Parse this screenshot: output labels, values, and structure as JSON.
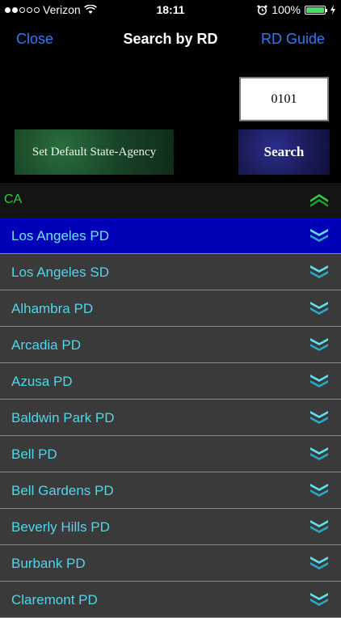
{
  "status_bar": {
    "carrier": "Verizon",
    "time": "18:11",
    "battery": "100%",
    "signal_bars": 2
  },
  "nav": {
    "close_label": "Close",
    "title": "Search by RD",
    "guide_label": "RD Guide"
  },
  "controls": {
    "rd_value": "0101",
    "default_state_label": "Set Default State-Agency",
    "search_label": "Search"
  },
  "state_header": {
    "state": "CA"
  },
  "agencies": [
    {
      "name": "Los Angeles PD",
      "selected": true
    },
    {
      "name": "Los Angeles SD",
      "selected": false
    },
    {
      "name": "Alhambra PD",
      "selected": false
    },
    {
      "name": "Arcadia PD",
      "selected": false
    },
    {
      "name": "Azusa PD",
      "selected": false
    },
    {
      "name": "Baldwin Park PD",
      "selected": false
    },
    {
      "name": "Bell PD",
      "selected": false
    },
    {
      "name": "Bell Gardens PD",
      "selected": false
    },
    {
      "name": "Beverly Hills PD",
      "selected": false
    },
    {
      "name": "Burbank PD",
      "selected": false
    },
    {
      "name": "Claremont PD",
      "selected": false
    }
  ],
  "colors": {
    "accent_blue": "#2f7bf6",
    "state_green": "#2ecc40",
    "agency_text": "#4fd6ea",
    "selected_row": "#0000b8"
  }
}
